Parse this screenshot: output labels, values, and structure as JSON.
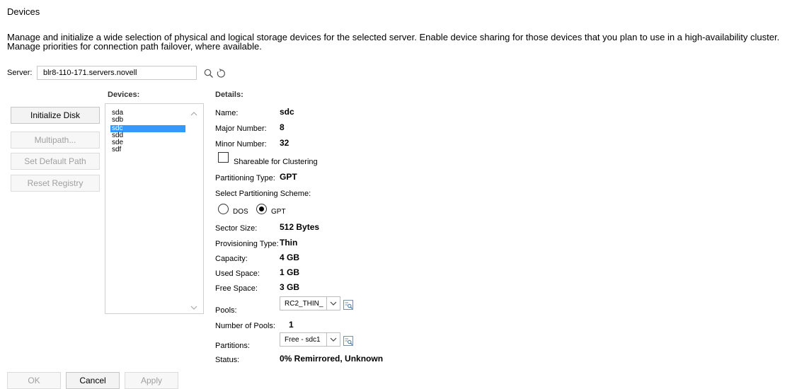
{
  "page": {
    "title": "Devices",
    "description": "Manage and initialize a wide selection of physical and logical storage devices for the selected server. Enable device sharing for those devices that you plan to use in a high-availability cluster. Manage priorities for connection path failover, where available."
  },
  "server": {
    "label": "Server:",
    "value": "blr8-110-171.servers.novell",
    "search_icon": "search-icon",
    "refresh_icon": "refresh-icon"
  },
  "actions": {
    "initialize": "Initialize Disk",
    "multipath": "Multipath...",
    "set_default_path": "Set Default Path",
    "reset_registry": "Reset Registry"
  },
  "devices": {
    "header": "Devices:",
    "items": [
      "sda",
      "sdb",
      "sdc",
      "sdd",
      "sde",
      "sdf"
    ],
    "selected": "sdc"
  },
  "details": {
    "header": "Details:",
    "name_label": "Name:",
    "name": "sdc",
    "major_label": "Major Number:",
    "major": "8",
    "minor_label": "Minor Number:",
    "minor": "32",
    "shareable_label": "Shareable for Clustering",
    "shareable_checked": false,
    "partitioning_type_label": "Partitioning Type:",
    "partitioning_type": "GPT",
    "scheme_label": "Select Partitioning Scheme:",
    "scheme_dos": "DOS",
    "scheme_gpt": "GPT",
    "scheme_selected": "GPT",
    "sector_size_label": "Sector Size:",
    "sector_size": "512 Bytes",
    "provisioning_label": "Provisioning Type:",
    "provisioning": "Thin",
    "capacity_label": "Capacity:",
    "capacity": "4 GB",
    "used_label": "Used Space:",
    "used": "1 GB",
    "free_label": "Free Space:",
    "free": "3 GB",
    "pools_label": "Pools:",
    "pools_selected": "RC2_THIN_",
    "num_pools_label": "Number of Pools:",
    "num_pools": "1",
    "partitions_label": "Partitions:",
    "partitions_selected": "Free - sdc1",
    "status_label": "Status:",
    "status": "0% Remirrored, Unknown"
  },
  "footer": {
    "ok": "OK",
    "cancel": "Cancel",
    "apply": "Apply"
  }
}
